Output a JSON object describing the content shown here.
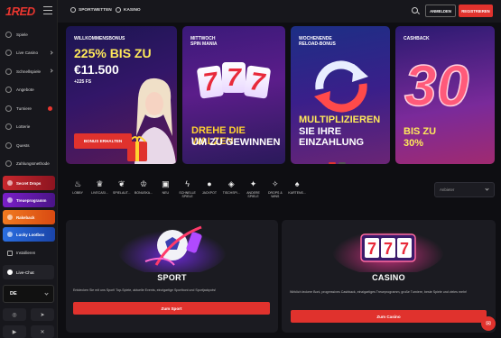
{
  "brand": {
    "logo": "1RED"
  },
  "header": {
    "links": [
      {
        "label": "SPORTWETTEN",
        "icon": "sport-icon"
      },
      {
        "label": "KASINO",
        "icon": "casino-icon"
      }
    ],
    "login_label": "ANMELDEN",
    "register_label": "REGISTRIEREN"
  },
  "sidebar": {
    "items": [
      {
        "label": "Spiele",
        "icon": "gamepad-icon"
      },
      {
        "label": "Live Casino",
        "icon": "live-icon"
      },
      {
        "label": "Schnellspiele",
        "icon": "bolt-icon"
      },
      {
        "label": "Angebote",
        "icon": "gift-icon"
      },
      {
        "label": "Turniere",
        "icon": "trophy-icon"
      },
      {
        "label": "Lotterie",
        "icon": "ticket-icon"
      },
      {
        "label": "Quests",
        "icon": "quest-icon"
      },
      {
        "label": "Zahlungsmethode",
        "icon": "wallet-icon"
      }
    ],
    "promos": [
      {
        "label": "Secret Drops"
      },
      {
        "label": "Treueprogramm"
      },
      {
        "label": "Rakeback"
      },
      {
        "label": "Lucky Lootbox"
      }
    ],
    "install_label": "Installieren",
    "chat_label": "Live-Chat",
    "language": "DE",
    "socials": [
      "instagram-icon",
      "telegram-icon",
      "youtube-icon",
      "x-icon"
    ]
  },
  "banners": [
    {
      "small": "WILLKOMMENSBONUS",
      "line1": "225% BIS ZU",
      "line2": "€11.500",
      "line3": "+225 FS",
      "button": "BONUS ERHALTEN"
    },
    {
      "small1": "MITTWOCH",
      "small2": "SPIN MANIA",
      "line1": "DREHE DIE WALZEN",
      "line2": "UM ZU GEWINNEN"
    },
    {
      "small1": "WOCHENENDE",
      "small2": "RELOAD-BONUS",
      "line1": "MULTIPLIZIEREN",
      "line2": "SIE IHRE",
      "line3": "EINZAHLUNG"
    },
    {
      "small": "CASHBACK",
      "line1": "BIS ZU",
      "line2": "30%"
    }
  ],
  "categories": [
    {
      "label": "LOBBY",
      "icon": "flame-icon"
    },
    {
      "label": "LIVECASI...",
      "icon": "live-icon"
    },
    {
      "label": "SPIELAUT...",
      "icon": "cherry-icon"
    },
    {
      "label": "BONUSKA...",
      "icon": "crown-icon"
    },
    {
      "label": "NEU",
      "icon": "new-icon"
    },
    {
      "label": "SCHNELLE SPIELE",
      "icon": "bolt-icon"
    },
    {
      "label": "JACKPOT",
      "icon": "moneybag-icon"
    },
    {
      "label": "TISCHSPI...",
      "icon": "dice-icon"
    },
    {
      "label": "ANDERE SPIELE",
      "icon": "rocket-icon"
    },
    {
      "label": "DROPS & WINS",
      "icon": "drops-icon"
    },
    {
      "label": "KARTENS...",
      "icon": "cards-icon"
    }
  ],
  "filter_placeholder": "Anbieter",
  "sections": [
    {
      "title": "SPORT",
      "text": "Entdecken Sie mit uns Sport! Top-Spiele, aktuelle Events, einzigartige Sportboni und Sportjackpots!",
      "button": "Zum Sport"
    },
    {
      "title": "CASINO",
      "text": "Wirklich leckere Boni, progressives Cashback, einzigartiges Treueprogramm, große Turniere, beste Spiele und vieles mehr!",
      "button": "Zum Casino"
    }
  ],
  "colors": {
    "accent": "#e0322d",
    "background": "#0e0e12",
    "sidebar": "#17171c",
    "card": "#1b1b21"
  }
}
